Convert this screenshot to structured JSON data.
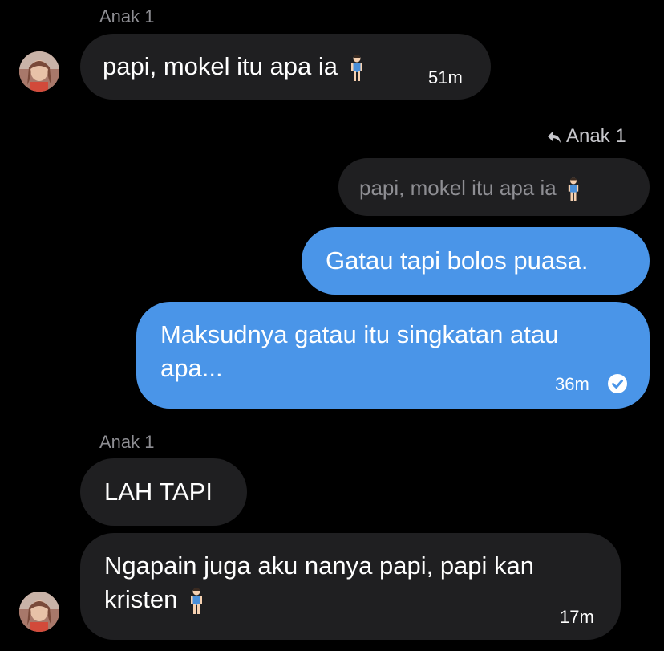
{
  "colors": {
    "background": "#000000",
    "incoming_bubble": "#1f1f21",
    "outgoing_bubble": "#4a95e8",
    "secondary_text": "#8e8e93"
  },
  "messages": [
    {
      "sender": "Anak 1",
      "text": "papi, mokel itu apa ia",
      "emoji": "person-standing-emoji",
      "time": "51m",
      "direction": "incoming"
    },
    {
      "reply_to_label": "Anak 1",
      "reply_icon": "reply-arrow-icon",
      "quoted_text": "papi, mokel itu apa ia",
      "quoted_emoji": "person-standing-emoji",
      "direction": "outgoing"
    },
    {
      "text": "Gatau tapi bolos puasa.",
      "direction": "outgoing"
    },
    {
      "text_line1": "Maksudnya gatau itu singkatan atau",
      "text_line2": "apa...",
      "time": "36m",
      "status_icon": "read-check-icon",
      "direction": "outgoing"
    },
    {
      "sender": "Anak 1",
      "text": "LAH TAPI",
      "direction": "incoming"
    },
    {
      "text_line1": "Ngapain juga aku nanya papi, papi kan",
      "text_line2": "kristen",
      "emoji": "person-standing-emoji",
      "time": "17m",
      "direction": "incoming"
    }
  ]
}
